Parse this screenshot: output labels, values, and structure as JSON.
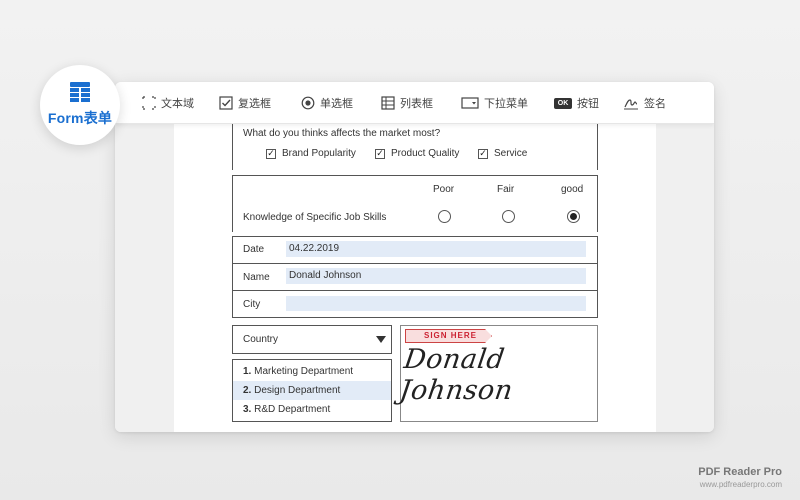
{
  "badge": {
    "label": "Form表单"
  },
  "toolbar": {
    "items": [
      {
        "label": "文本域",
        "icon": "text-field-icon"
      },
      {
        "label": "复选框",
        "icon": "checkbox-icon"
      },
      {
        "label": "单选框",
        "icon": "radio-button-icon"
      },
      {
        "label": "列表框",
        "icon": "list-box-icon"
      },
      {
        "label": "下拉菜单",
        "icon": "dropdown-menu-icon"
      },
      {
        "label": "按钮",
        "icon": "button-icon",
        "icon_text": "OK"
      },
      {
        "label": "签名",
        "icon": "signature-icon"
      }
    ]
  },
  "form": {
    "question": "What do you thinks affects the market most?",
    "checkboxes": [
      {
        "label": "Brand Popularity",
        "checked": true
      },
      {
        "label": "Product Quality",
        "checked": true
      },
      {
        "label": "Service",
        "checked": true
      }
    ],
    "rating": {
      "columns": [
        "Poor",
        "Fair",
        "good"
      ],
      "row_label": "Knowledge of Specific Job Skills",
      "selected": "good"
    },
    "date": {
      "label": "Date",
      "value": "04.22.2019"
    },
    "name": {
      "label": "Name",
      "value": "Donald Johnson"
    },
    "city": {
      "label": "City",
      "value": ""
    },
    "country": {
      "selected": "Country"
    },
    "list": [
      {
        "number": "1.",
        "label": "Marketing Department",
        "selected": false
      },
      {
        "number": "2.",
        "label": "Design Department",
        "selected": true
      },
      {
        "number": "3.",
        "label": "R&D Department",
        "selected": false
      }
    ],
    "signature": {
      "tag": "SIGN HERE",
      "text": "Donald Johnson"
    }
  },
  "brand": {
    "name": "PDF Reader Pro",
    "url": "www.pdfreaderpro.com"
  },
  "colors": {
    "accent": "#1a6fd0",
    "field_fill": "#e2ebf7",
    "sign_tag": "#c23333"
  }
}
